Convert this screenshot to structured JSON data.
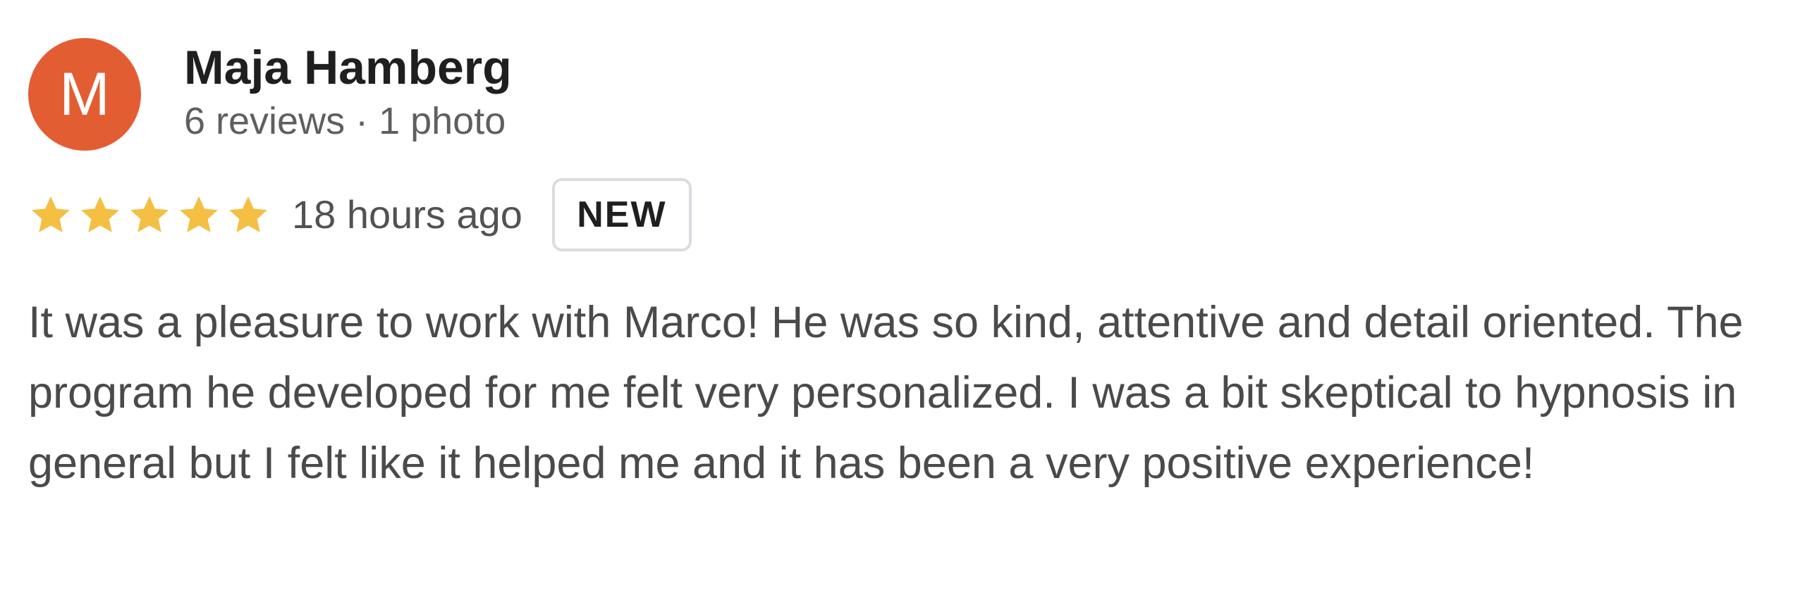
{
  "reviewer": {
    "avatar_initial": "M",
    "avatar_color": "#e35d33",
    "name": "Maja Hamberg",
    "meta": "6 reviews · 1 photo"
  },
  "rating": {
    "stars": 5,
    "max_stars": 5,
    "star_color": "#f4bf42",
    "time_ago": "18 hours ago",
    "badge": "NEW"
  },
  "review": {
    "text": "It was a pleasure to work with Marco! He was so kind, attentive and detail oriented. The program he developed for me felt very personalized. I was a bit skeptical to hypnosis in general but I felt like it helped me and it has been a very positive experience!"
  }
}
